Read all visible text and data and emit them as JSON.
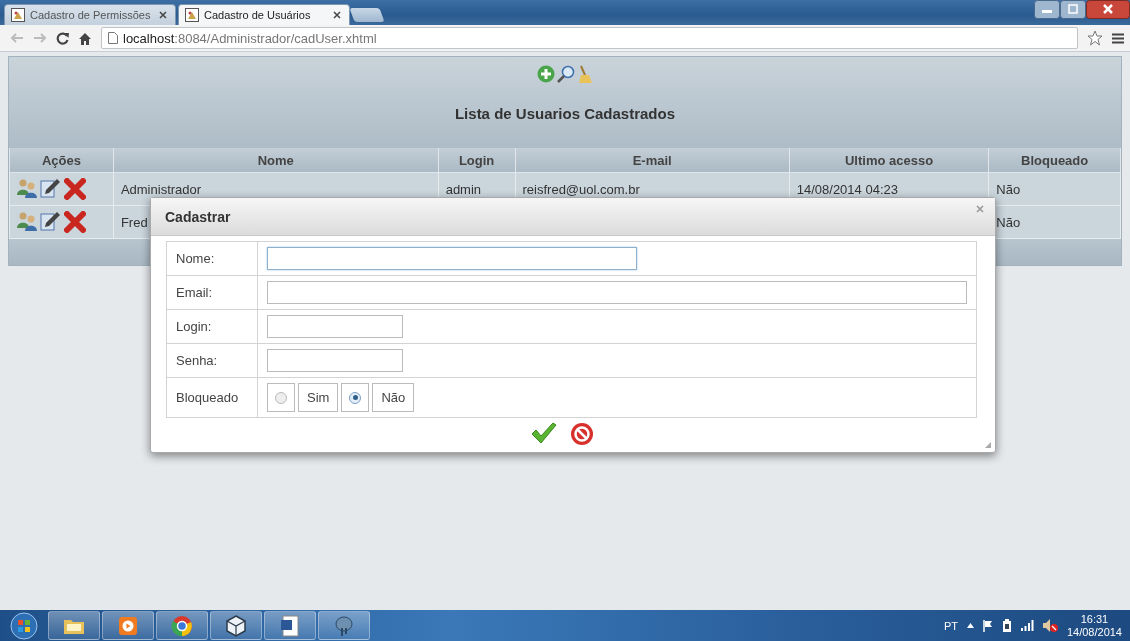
{
  "browser": {
    "tabs": [
      {
        "title": "Cadastro de Permissões",
        "selected": false
      },
      {
        "title": "Cadastro de Usuários",
        "selected": true
      }
    ],
    "address": {
      "host": "localhost",
      "path": ":8084/Administrador/cadUser.xhtml"
    }
  },
  "list": {
    "title": "Lista de Usuarios Cadastrados",
    "columns": [
      "Ações",
      "Nome",
      "Login",
      "E-mail",
      "Ultimo acesso",
      "Bloqueado"
    ],
    "rows": [
      {
        "nome": "Administrador",
        "login": "admin",
        "email": "reisfred@uol.com.br",
        "ultimo_acesso": "14/08/2014 04:23",
        "bloqueado": "Não"
      },
      {
        "nome": "Fred",
        "bloqueado": "Não"
      }
    ]
  },
  "dialog": {
    "title": "Cadastrar",
    "fields": [
      {
        "label": "Nome:",
        "kind": "text",
        "focused": true
      },
      {
        "label": "Email:",
        "kind": "text",
        "focused": false
      },
      {
        "label": "Login:",
        "kind": "text",
        "focused": false
      },
      {
        "label": "Senha:",
        "kind": "text",
        "focused": false
      },
      {
        "label": "Bloqueado",
        "kind": "radio",
        "options": [
          {
            "label": "Sim",
            "selected": false
          },
          {
            "label": "Não",
            "selected": true
          }
        ]
      }
    ]
  },
  "taskbar": {
    "language": "PT",
    "time": "16:31",
    "date": "14/08/2014"
  }
}
